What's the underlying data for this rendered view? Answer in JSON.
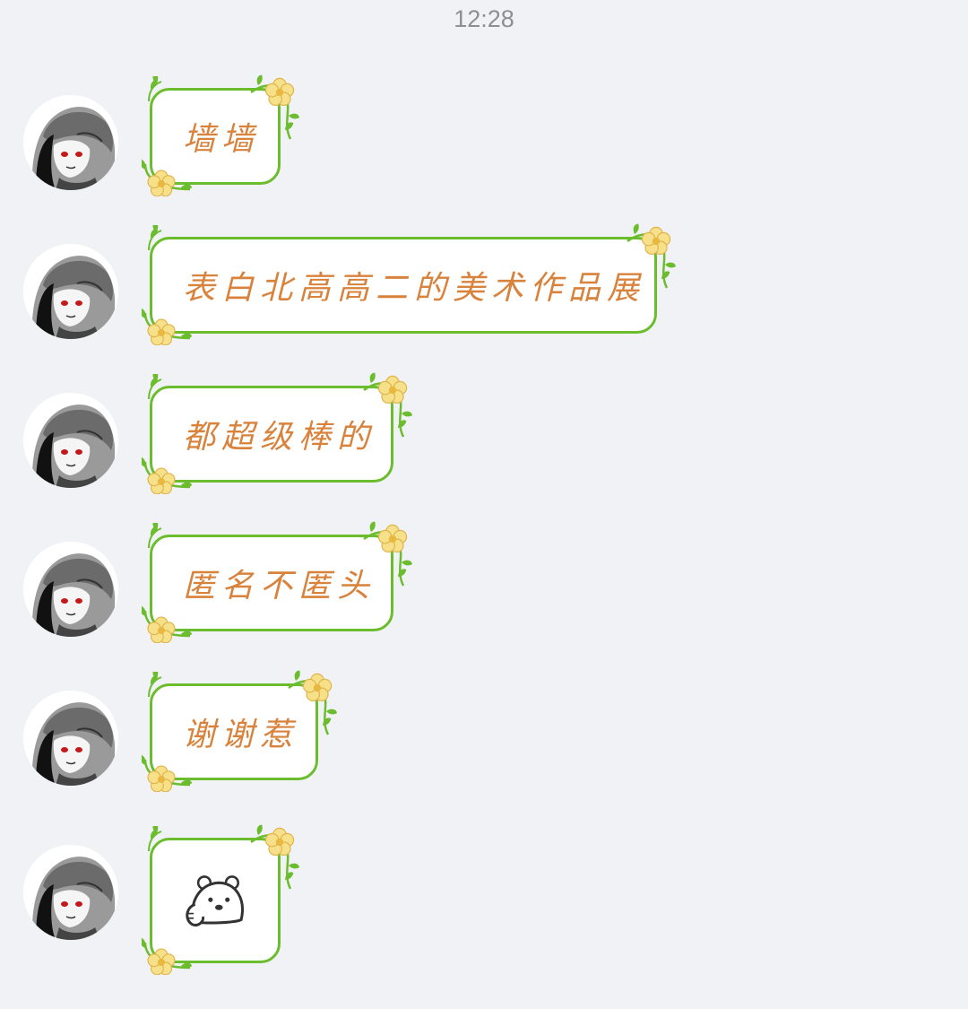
{
  "timestamp": "12:28",
  "messages": [
    {
      "type": "text",
      "text": "墙墙"
    },
    {
      "type": "text",
      "text": "表白北高高二的美术作品展"
    },
    {
      "type": "text",
      "text": "都超级棒的"
    },
    {
      "type": "text",
      "text": "匿名不匿头"
    },
    {
      "type": "text",
      "text": "谢谢惹"
    },
    {
      "type": "sticker",
      "sticker": "bear-thinking-sticker"
    }
  ],
  "colors": {
    "background": "#f1f2f6",
    "bubble_border": "#6cbd2e",
    "text": "#d8823c",
    "flower": "#f7e08a"
  }
}
